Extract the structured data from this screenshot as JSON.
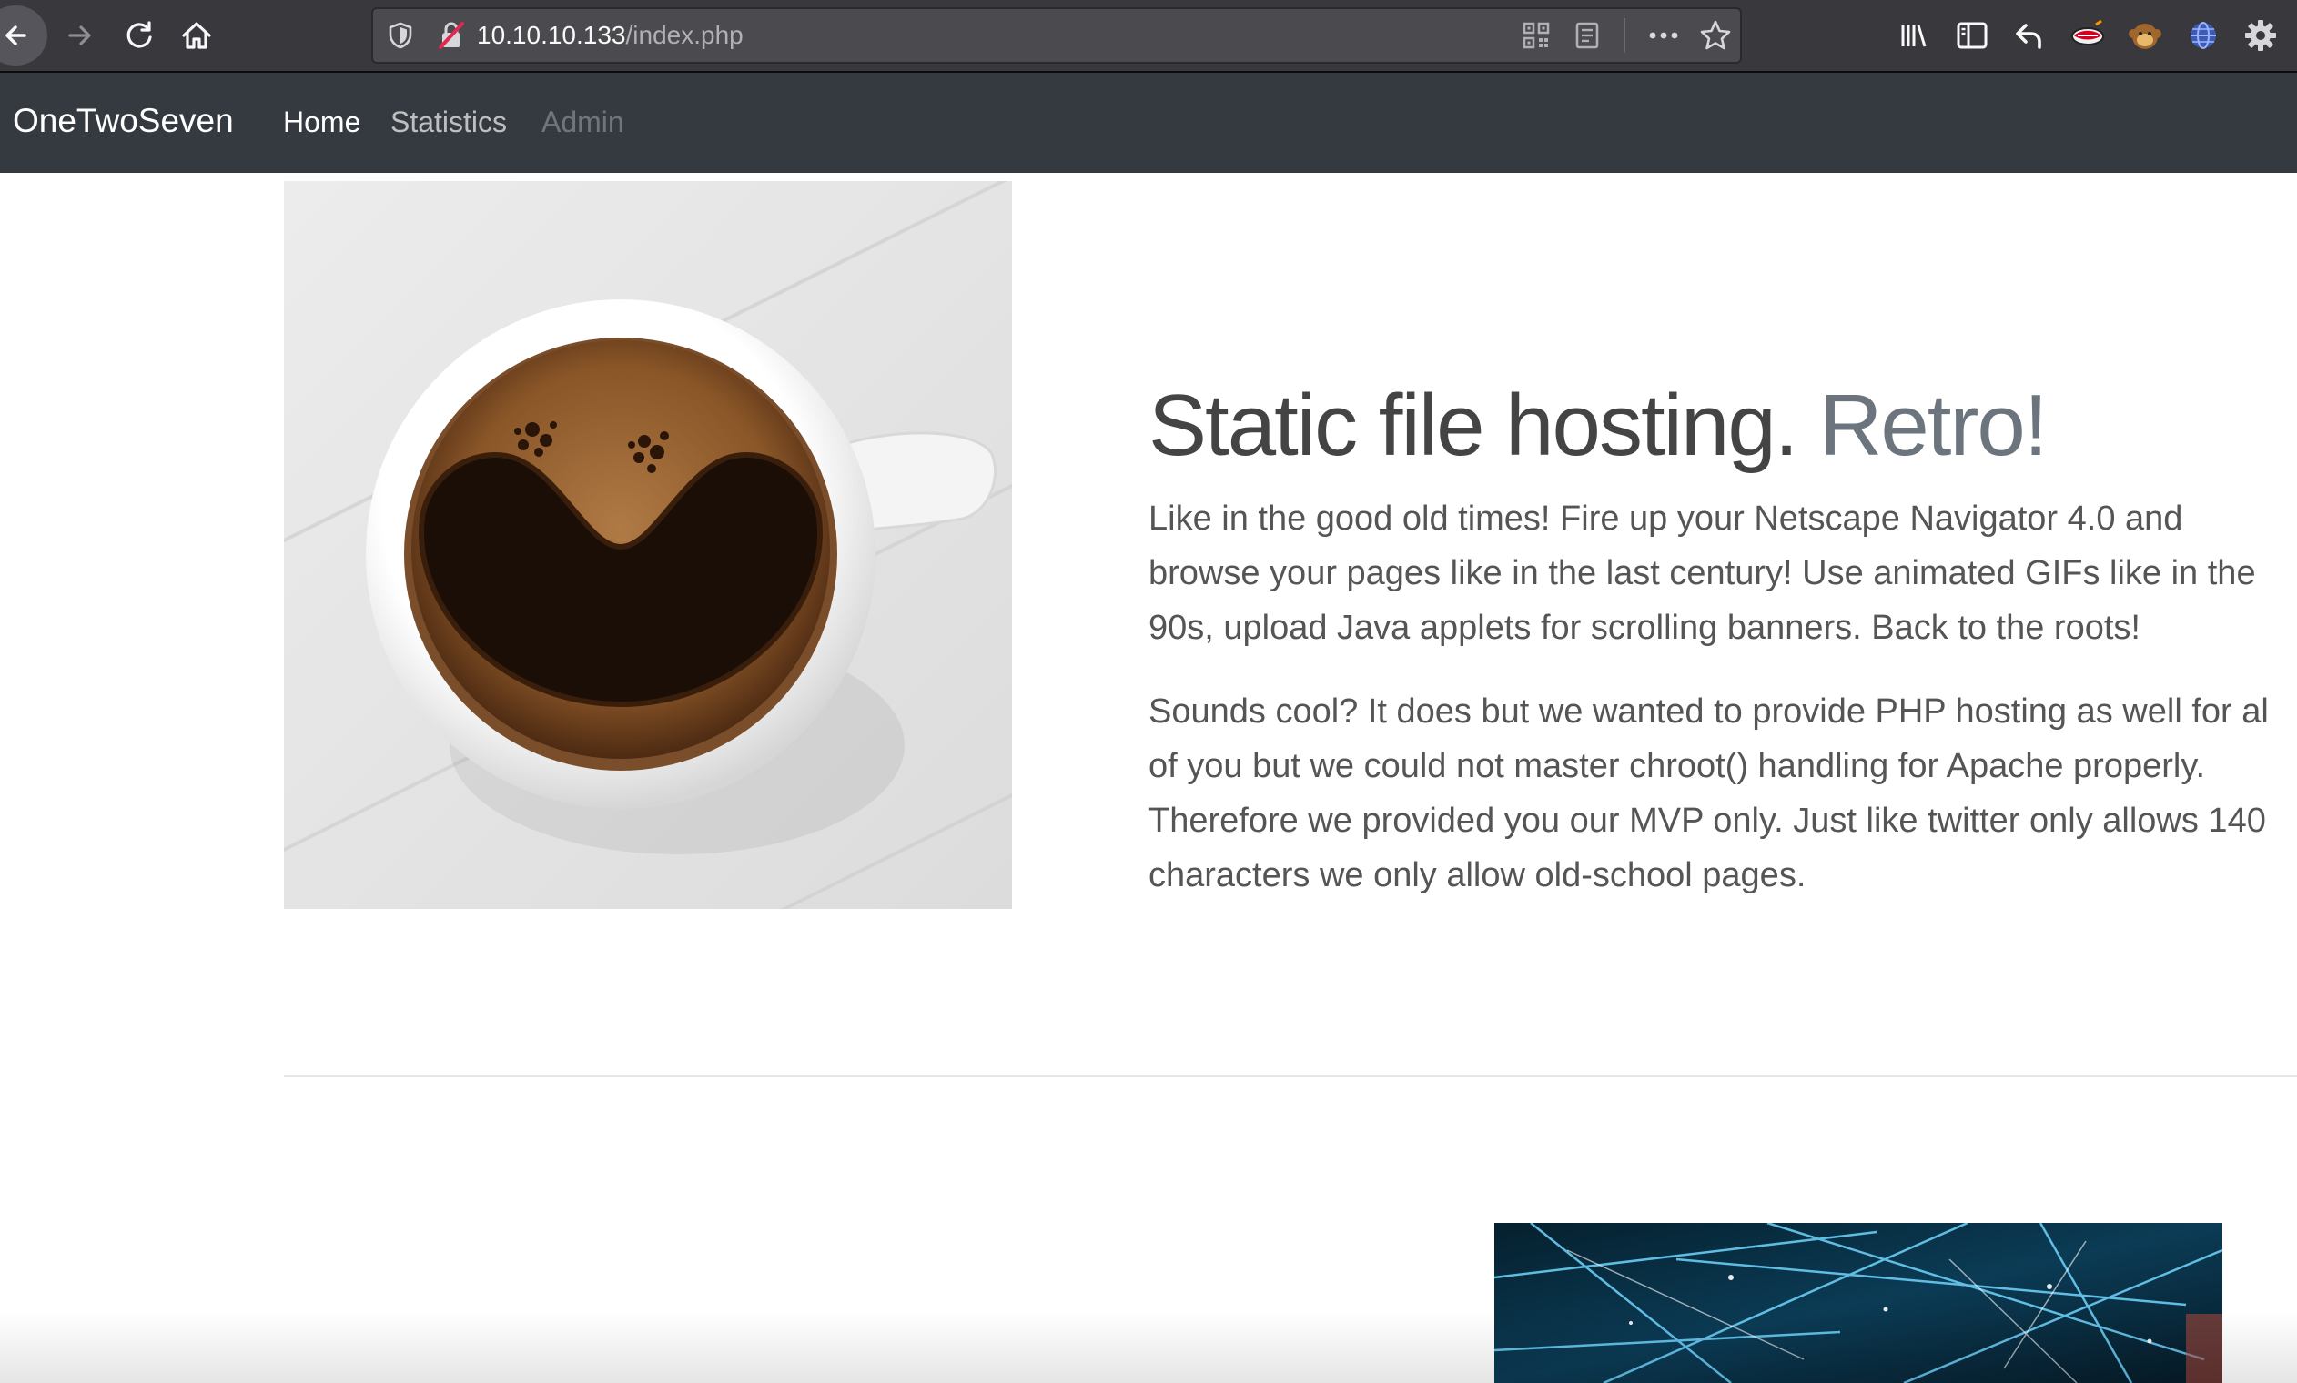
{
  "browser": {
    "url_host": "10.10.10.133",
    "url_path": "/index.php",
    "icons": [
      "back-arrow-icon",
      "forward-arrow-icon",
      "reload-icon",
      "home-icon",
      "shield-icon",
      "insecure-lock-icon",
      "qr-code-icon",
      "reader-view-icon",
      "more-actions-icon",
      "bookmark-star-icon",
      "library-icon",
      "sidebar-icon",
      "undo-arrow-icon",
      "lips-extension-icon",
      "monkey-extension-icon",
      "globe-extension-icon",
      "gear-extension-icon"
    ]
  },
  "nav": {
    "brand": "OneTwoSeven",
    "links": [
      {
        "label": "Home",
        "state": "active"
      },
      {
        "label": "Statistics",
        "state": "normal"
      },
      {
        "label": "Admin",
        "state": "disabled"
      }
    ]
  },
  "featurette": {
    "heading": "Static file hosting.",
    "heading_muted": "Retro!",
    "paragraph1_lines": [
      "Like in the good old times! Fire up your Netscape Navigator 4.0 and",
      "browse your pages like in the last century! Use animated GIFs like in the",
      "90s, upload Java applets for scrolling banners. Back to the roots!"
    ],
    "paragraph2_lines": [
      "Sounds cool? It does but we wanted to provide PHP hosting as well for al",
      "of you but we could not master chroot() handling for Apache properly.",
      "Therefore we provided you our MVP only. Just like twitter only allows 140",
      "characters we only allow old-school pages."
    ]
  },
  "colors": {
    "navbar_bg": "#343a40",
    "toolbar_bg": "#38383d",
    "urlbar_bg": "#4a4a4f",
    "heading_text": "#444444",
    "muted_text": "#6c757d"
  }
}
